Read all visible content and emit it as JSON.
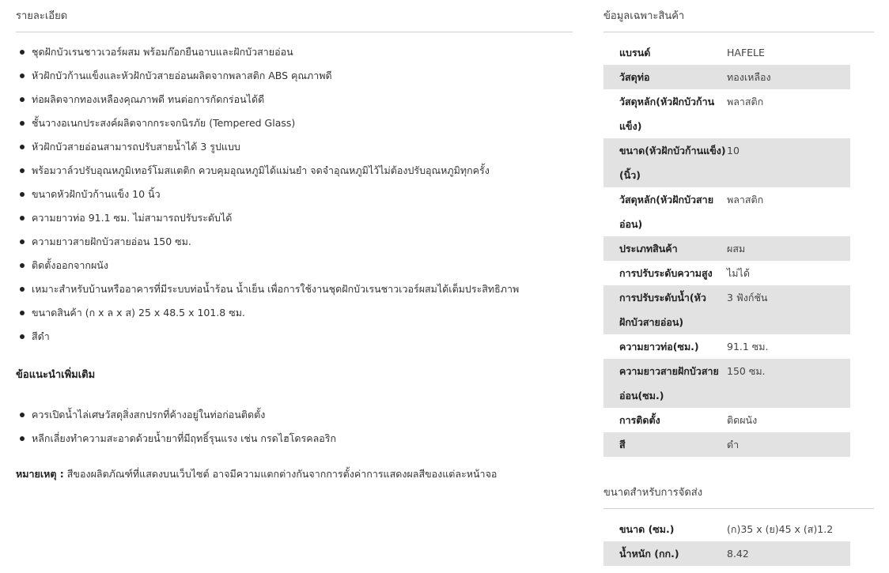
{
  "details": {
    "title": "รายละเอียด",
    "bullets": [
      "ชุดฝักบัวเรนชาวเวอร์ผสม พร้อมก๊อกยืนอาบและฝักบัวสายอ่อน",
      "หัวฝักบัวก้านแข็งและหัวฝักบัวสายอ่อนผลิตจากพลาสติก ABS คุณภาพดี",
      "ท่อผลิตจากทองเหลืองคุณภาพดี ทนต่อการกัดกร่อนได้ดี",
      "ชั้นวางอเนกประสงค์ผลิตจากกระจกนิรภัย (Tempered Glass)",
      "หัวฝักบัวสายอ่อนสามารถปรับสายน้ำได้ 3 รูปแบบ",
      "พร้อมวาล์วปรับอุณหภูมิเทอร์โมสแตติก ควบคุมอุณหภูมิได้แม่นยำ จดจำอุณหภูมิไว้ไม่ต้องปรับอุณหภูมิทุกครั้ง",
      "ขนาดหัวฝักบัวก้านแข็ง 10 นิ้ว",
      "ความยาวท่อ 91.1 ซม. ไม่สามารถปรับระดับได้",
      "ความยาวสายฝักบัวสายอ่อน 150 ซม.",
      "ติดตั้งออกจากผนัง",
      "เหมาะสำหรับบ้านหรืออาคารที่มีระบบท่อน้ำร้อน น้ำเย็น เพื่อการใช้งานชุดฝักบัวเรนชาวเวอร์ผสมได้เต็มประสิทธิภาพ",
      "ขนาดสินค้า (ก x ล x ส) 25 x 48.5 x 101.8 ซม.",
      "สีดำ"
    ],
    "advice_title": "ข้อแนะนำเพิ่มเติม",
    "advice": [
      "ควรเปิดน้ำไล่เศษวัสดุสิ่งสกปรกที่ค้างอยู่ในท่อก่อนติดตั้ง",
      "หลีกเลี่ยงทำความสะอาดด้วยน้ำยาที่มีฤทธิ์รุนแรง เช่น กรดไฮโดรคลอริก"
    ],
    "note_label": "หมายเหตุ :",
    "note_text": "สีของผลิตภัณฑ์ที่แสดงบนเว็บไซต์ อาจมีความแตกต่างกันจากการตั้งค่าการแสดงผลสีของแต่ละหน้าจอ"
  },
  "specs": {
    "title": "ข้อมูลเฉพาะสินค้า",
    "rows": [
      {
        "label": "แบรนด์",
        "value": "HAFELE"
      },
      {
        "label": "วัสดุท่อ",
        "value": "ทองเหลือง"
      },
      {
        "label": "วัสดุหลัก(หัวฝักบัวก้านแข็ง)",
        "value": "พลาสติก"
      },
      {
        "label": "ขนาด(หัวฝักบัวก้านแข็ง)(นิ้ว)",
        "value": "10"
      },
      {
        "label": "วัสดุหลัก(หัวฝักบัวสายอ่อน)",
        "value": "พลาสติก"
      },
      {
        "label": "ประเภทสินค้า",
        "value": "ผสม"
      },
      {
        "label": "การปรับระดับความสูง",
        "value": "ไม่ได้"
      },
      {
        "label": "การปรับระดับน้ำ(หัวฝักบัวสายอ่อน)",
        "value": "3 ฟังก์ชัน"
      },
      {
        "label": "ความยาวท่อ(ซม.)",
        "value": "91.1 ซม."
      },
      {
        "label": "ความยาวสายฝักบัวสายอ่อน(ซม.)",
        "value": "150 ซม."
      },
      {
        "label": "การติดตั้ง",
        "value": "ติดผนัง"
      },
      {
        "label": "สี",
        "value": "ดำ"
      }
    ]
  },
  "shipping": {
    "title": "ขนาดสำหรับการจัดส่ง",
    "rows": [
      {
        "label": "ขนาด (ซม.)",
        "value": "(ก)35 x (ย)45 x (ส)1.2"
      },
      {
        "label": "น้ำหนัก (กก.)",
        "value": "8.42"
      }
    ]
  }
}
